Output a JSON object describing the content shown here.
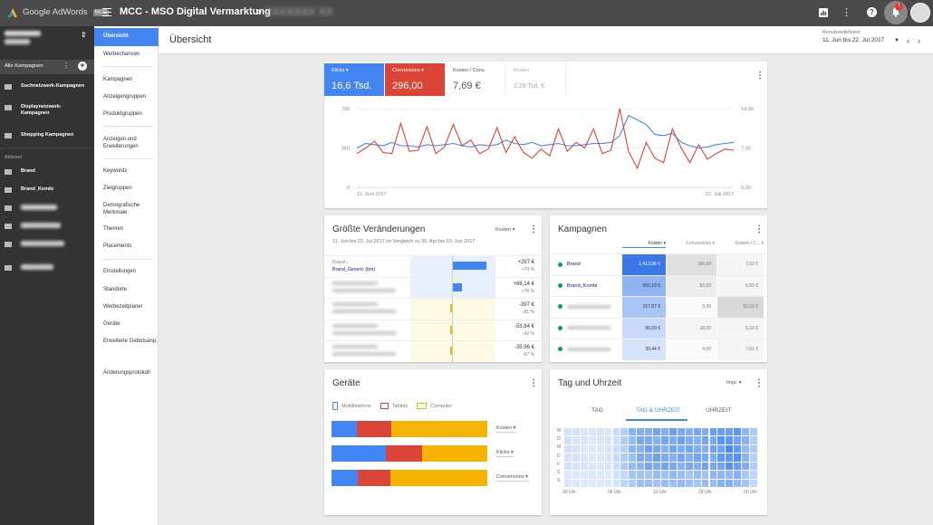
{
  "app": {
    "name": "Google AdWords",
    "badge": "MCC"
  },
  "header": {
    "account": "MCC - MSO Digital Vermarktung",
    "crumb_sep": ">",
    "crumb_blurred": "XXXXXXX XX"
  },
  "sidebar": {
    "account_blurred": "XXXXXXXXXX",
    "all_campaigns": "Alle Kampagnen",
    "types": [
      {
        "label": "Suchnetzwerk-Kampagnen",
        "icon": "search-network-icon"
      },
      {
        "label": "Displaynetzwerk-Kampagnen",
        "icon": "display-network-icon"
      },
      {
        "label": "Shopping Kampagnen",
        "icon": "shopping-icon"
      }
    ],
    "section": "Aktiviert",
    "campaigns": [
      {
        "label": "Brand",
        "icon": "search-network-icon"
      },
      {
        "label": "Brand_Kombi",
        "icon": "search-network-icon"
      }
    ]
  },
  "subnav": {
    "active": "Übersicht",
    "items": [
      "Werbechancen",
      "Kampagnen",
      "Anzeigengruppen",
      "Produktgruppen",
      "Anzeigen und Erweiterungen",
      "Keywords",
      "Zielgruppen",
      "Demografische Merkmale",
      "Themen",
      "Placements",
      "Einstellungen",
      "Standorte",
      "Werbezeitplaner",
      "Geräte",
      "Erweiterte Gebotsanp.",
      "Änderungsprotokoll"
    ]
  },
  "page": {
    "title": "Übersicht",
    "range_label": "Benutzerdefiniert",
    "range_value": "11. Jun bis 22. Jul 2017"
  },
  "summary": {
    "metrics": [
      {
        "label": "Klicks",
        "value": "16,6 Tsd.",
        "color": "#4285f4"
      },
      {
        "label": "Conversions",
        "value": "296,00",
        "color": "#db4437"
      },
      {
        "label": "Kosten / Conv.",
        "value": "7,69 €"
      },
      {
        "label": "Kosten",
        "value": "2,28 Tsd. €"
      }
    ]
  },
  "chart_data": {
    "type": "line",
    "x_start": "11. Juni 2017",
    "x_end": "22. Juli 2017",
    "left_axis": [
      "700",
      "350",
      "0"
    ],
    "right_axis": [
      "14,00",
      "7,00",
      "0,00"
    ],
    "ylim_left": [
      0,
      700
    ],
    "ylim_right": [
      0,
      14
    ],
    "series": [
      {
        "name": "Klicks",
        "axis": "left",
        "color": "#4285f4",
        "values": [
          350,
          390,
          380,
          370,
          400,
          370,
          370,
          360,
          380,
          370,
          380,
          390,
          370,
          360,
          380,
          370,
          380,
          420,
          390,
          380,
          400,
          370,
          380,
          390,
          370,
          370,
          380,
          390,
          390,
          400,
          460,
          640,
          600,
          560,
          470,
          460,
          480,
          400,
          370,
          350,
          360,
          380,
          390,
          400
        ]
      },
      {
        "name": "Conversions",
        "axis": "left",
        "color": "#db4437",
        "values": [
          300,
          350,
          410,
          310,
          300,
          570,
          320,
          330,
          540,
          300,
          360,
          560,
          370,
          420,
          300,
          340,
          530,
          310,
          450,
          310,
          260,
          340,
          280,
          520,
          320,
          400,
          350,
          520,
          300,
          330,
          700,
          320,
          170,
          400,
          260,
          220,
          520,
          350,
          220,
          380,
          250,
          300,
          340,
          330
        ]
      }
    ]
  },
  "changes": {
    "title": "Größte Veränderungen",
    "sort": "Kosten",
    "range": "11. Jun bis 22. Jul 2017 im Vergleich zu 30. Apr bis 10. Jun 2017",
    "rows": [
      {
        "line1": "Brand ›",
        "line2": "Brand_Generic (bm)",
        "value": "+297 €",
        "pct": "+70 %",
        "up": true,
        "level": 0.8
      },
      {
        "line1": "XXXXX",
        "line2": "XXXXXX",
        "value": "+68,14 €",
        "pct": "+76 %",
        "up": true,
        "level": 0.22
      },
      {
        "line1": "XXXXX",
        "line2": "XXXXXX",
        "value": "-397 €",
        "pct": "-81 %",
        "up": false,
        "level": 0.02
      },
      {
        "line1": "XXXXX",
        "line2": "XXXXXX",
        "value": "-53,84 €",
        "pct": "-42 %",
        "up": false,
        "level": 0.02
      },
      {
        "line1": "XXXXX",
        "line2": "XXXXXX",
        "value": "-35,96 €",
        "pct": "-67 %",
        "up": false,
        "level": 0.02
      }
    ]
  },
  "campaigns": {
    "title": "Kampagnen",
    "headers": [
      "Kosten",
      "Conversions",
      "Kosten / C..."
    ],
    "rows": [
      {
        "name": "Brand",
        "kosten": "1.413,96 €",
        "conv": "188,00",
        "kpc": "7,52 €"
      },
      {
        "name": "Brand_Kombi",
        "kosten": "560,19 €",
        "conv": "82,00",
        "kpc": "6,83 €"
      },
      {
        "name": "XXXXX",
        "kosten": "157,87 €",
        "conv": "3,00",
        "kpc": "52,62 €"
      },
      {
        "name": "XXXXX",
        "kosten": "96,00 €",
        "conv": "18,00",
        "kpc": "5,33 €"
      },
      {
        "name": "XXXXX",
        "kosten": "30,44 €",
        "conv": "4,00",
        "kpc": "7,61 €"
      }
    ]
  },
  "devices": {
    "title": "Geräte",
    "legend": [
      "Mobiltelefone",
      "Tablets",
      "Computer"
    ],
    "rows": [
      {
        "metric": "Kosten",
        "mobile": 0.16,
        "tablet": 0.22,
        "computer": 0.62
      },
      {
        "metric": "Klicks",
        "mobile": 0.35,
        "tablet": 0.23,
        "computer": 0.42
      },
      {
        "metric": "Conversions",
        "mobile": 0.17,
        "tablet": 0.21,
        "computer": 0.62
      }
    ]
  },
  "dayhour": {
    "title": "Tag und Uhrzeit",
    "metric": "Impr.",
    "tabs": [
      "TAG",
      "TAG & UHRZEIT",
      "UHRZEIT"
    ],
    "days": [
      "M",
      "D",
      "M",
      "D",
      "F",
      "S",
      "S"
    ],
    "hours": [
      "00 Uhr",
      "06 Uhr",
      "12 Uhr",
      "18 Uhr",
      "00 Uhr"
    ]
  },
  "colors": {
    "blue": "#4285f4",
    "red": "#db4437",
    "yellow": "#f4b400",
    "green": "#0f9d58"
  }
}
